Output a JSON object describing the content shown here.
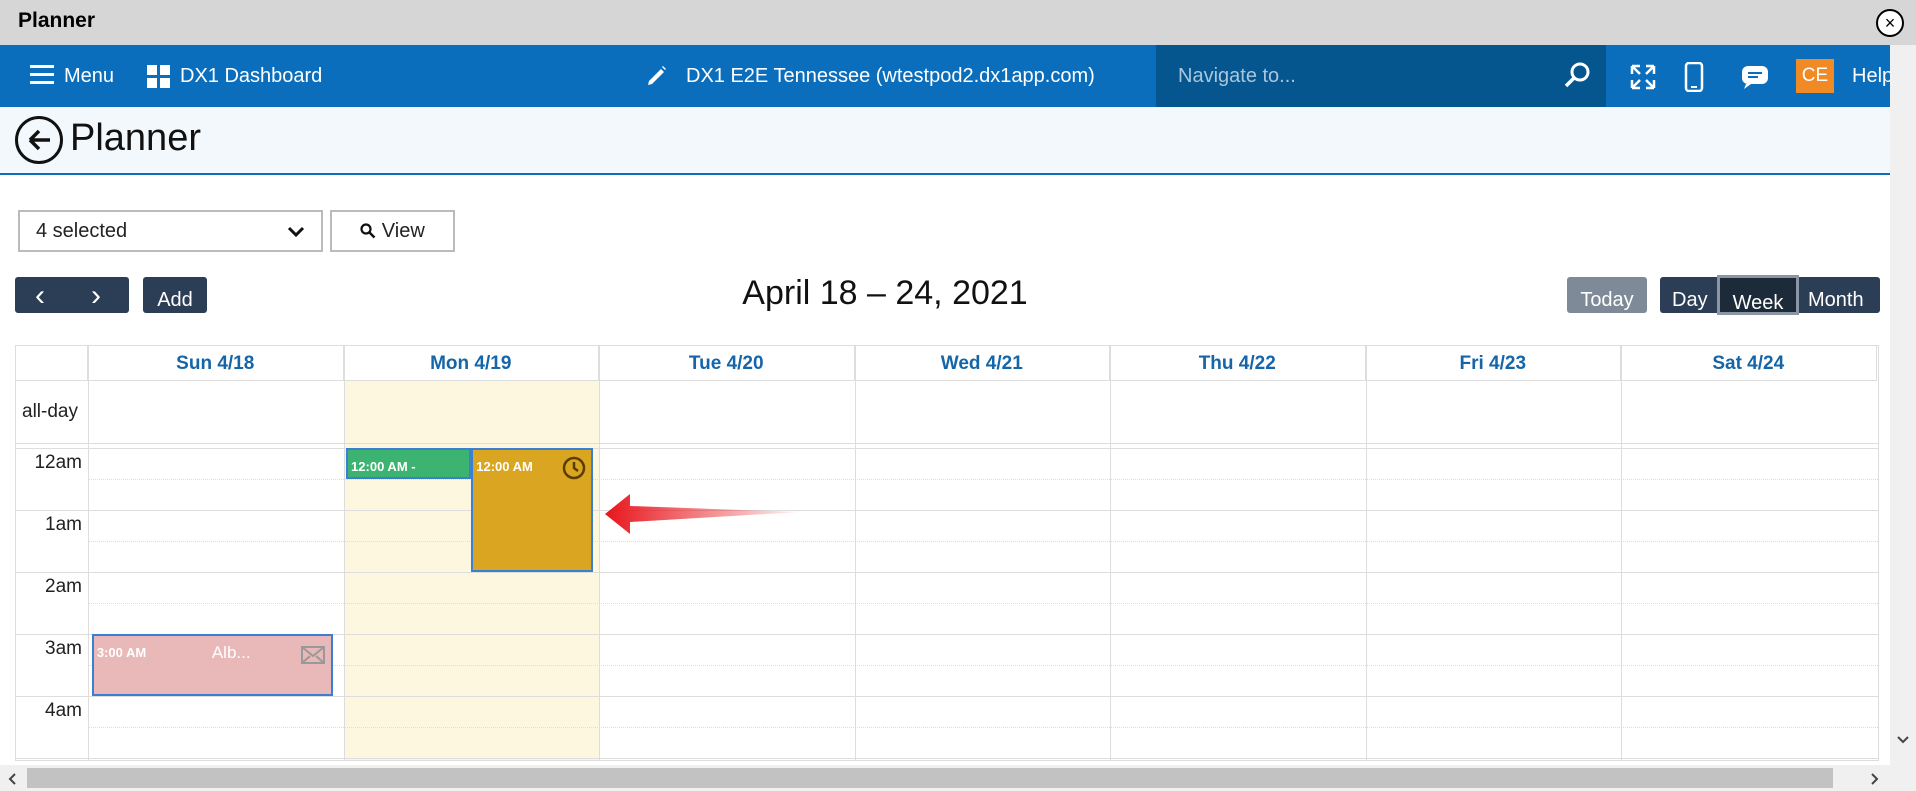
{
  "window": {
    "title": "Planner",
    "close_icon": "close-icon"
  },
  "topnav": {
    "menu_label": "Menu",
    "dashboard_label": "DX1 Dashboard",
    "site_label": "DX1 E2E Tennessee (wtestpod2.dx1app.com)",
    "search_placeholder": "Navigate to...",
    "user_initials": "CE",
    "help_label": "Help"
  },
  "page": {
    "title": "Planner"
  },
  "toolbar": {
    "filter_value": "4 selected",
    "view_label": "View",
    "prev_label": "‹",
    "next_label": "›",
    "add_label": "Add",
    "date_range": "April 18 – 24, 2021",
    "today_label": "Today",
    "day_label": "Day",
    "week_label": "Week",
    "month_label": "Month"
  },
  "calendar": {
    "allday_label": "all-day",
    "days": [
      "Sun 4/18",
      "Mon 4/19",
      "Tue 4/20",
      "Wed 4/21",
      "Thu 4/22",
      "Fri 4/23",
      "Sat 4/24"
    ],
    "hours": [
      "12am",
      "1am",
      "2am",
      "3am",
      "4am"
    ],
    "today_index": 1,
    "events": [
      {
        "day": "Mon 4/19",
        "start": "12:00 AM",
        "label": "12:00 AM -",
        "color": "#3cb371"
      },
      {
        "day": "Mon 4/19",
        "start": "12:00 AM",
        "label": "12:00 AM",
        "color": "#daa520",
        "icon": "clock-icon"
      },
      {
        "day": "Sun 4/18",
        "start": "3:00 AM",
        "label": "3:00 AM",
        "title": "Alb...",
        "color": "#e9b8b8",
        "icon": "envelope-icon"
      }
    ]
  },
  "colors": {
    "nav": "#0a6ebd",
    "search_bg": "#05568f",
    "accent_orange": "#f08a24",
    "dark_btn": "#2c3e55",
    "today_bg": "#fdf7e0",
    "annotation": "#e8151b"
  }
}
